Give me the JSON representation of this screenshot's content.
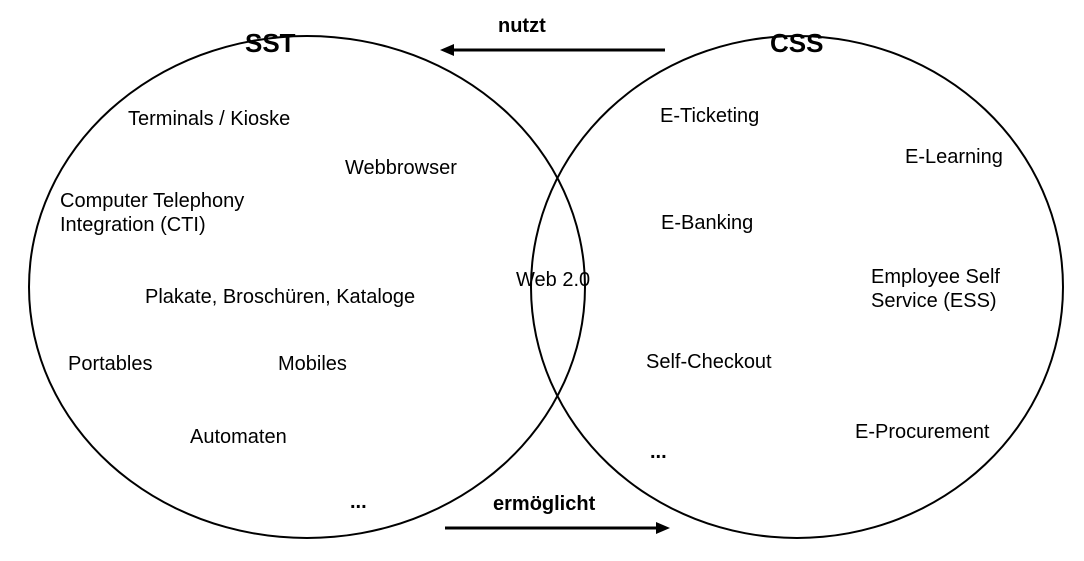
{
  "left": {
    "title": "SST",
    "items": {
      "terminals": "Terminals / Kioske",
      "webbrowser": "Webbrowser",
      "cti": "Computer Telephony Integration (CTI)",
      "plakate": "Plakate, Broschüren, Kataloge",
      "portables": "Portables",
      "mobiles": "Mobiles",
      "automaten": "Automaten",
      "more": "..."
    }
  },
  "right": {
    "title": "CSS",
    "items": {
      "eticketing": "E-Ticketing",
      "elearning": "E-Learning",
      "ebanking": "E-Banking",
      "ess": "Employee Self Service (ESS)",
      "selfcheckout": "Self-Checkout",
      "eprocurement": "E-Procurement",
      "more": "..."
    }
  },
  "intersection": {
    "web20": "Web 2.0"
  },
  "relations": {
    "nutzt": "nutzt",
    "ermoeglicht": "ermöglicht"
  }
}
